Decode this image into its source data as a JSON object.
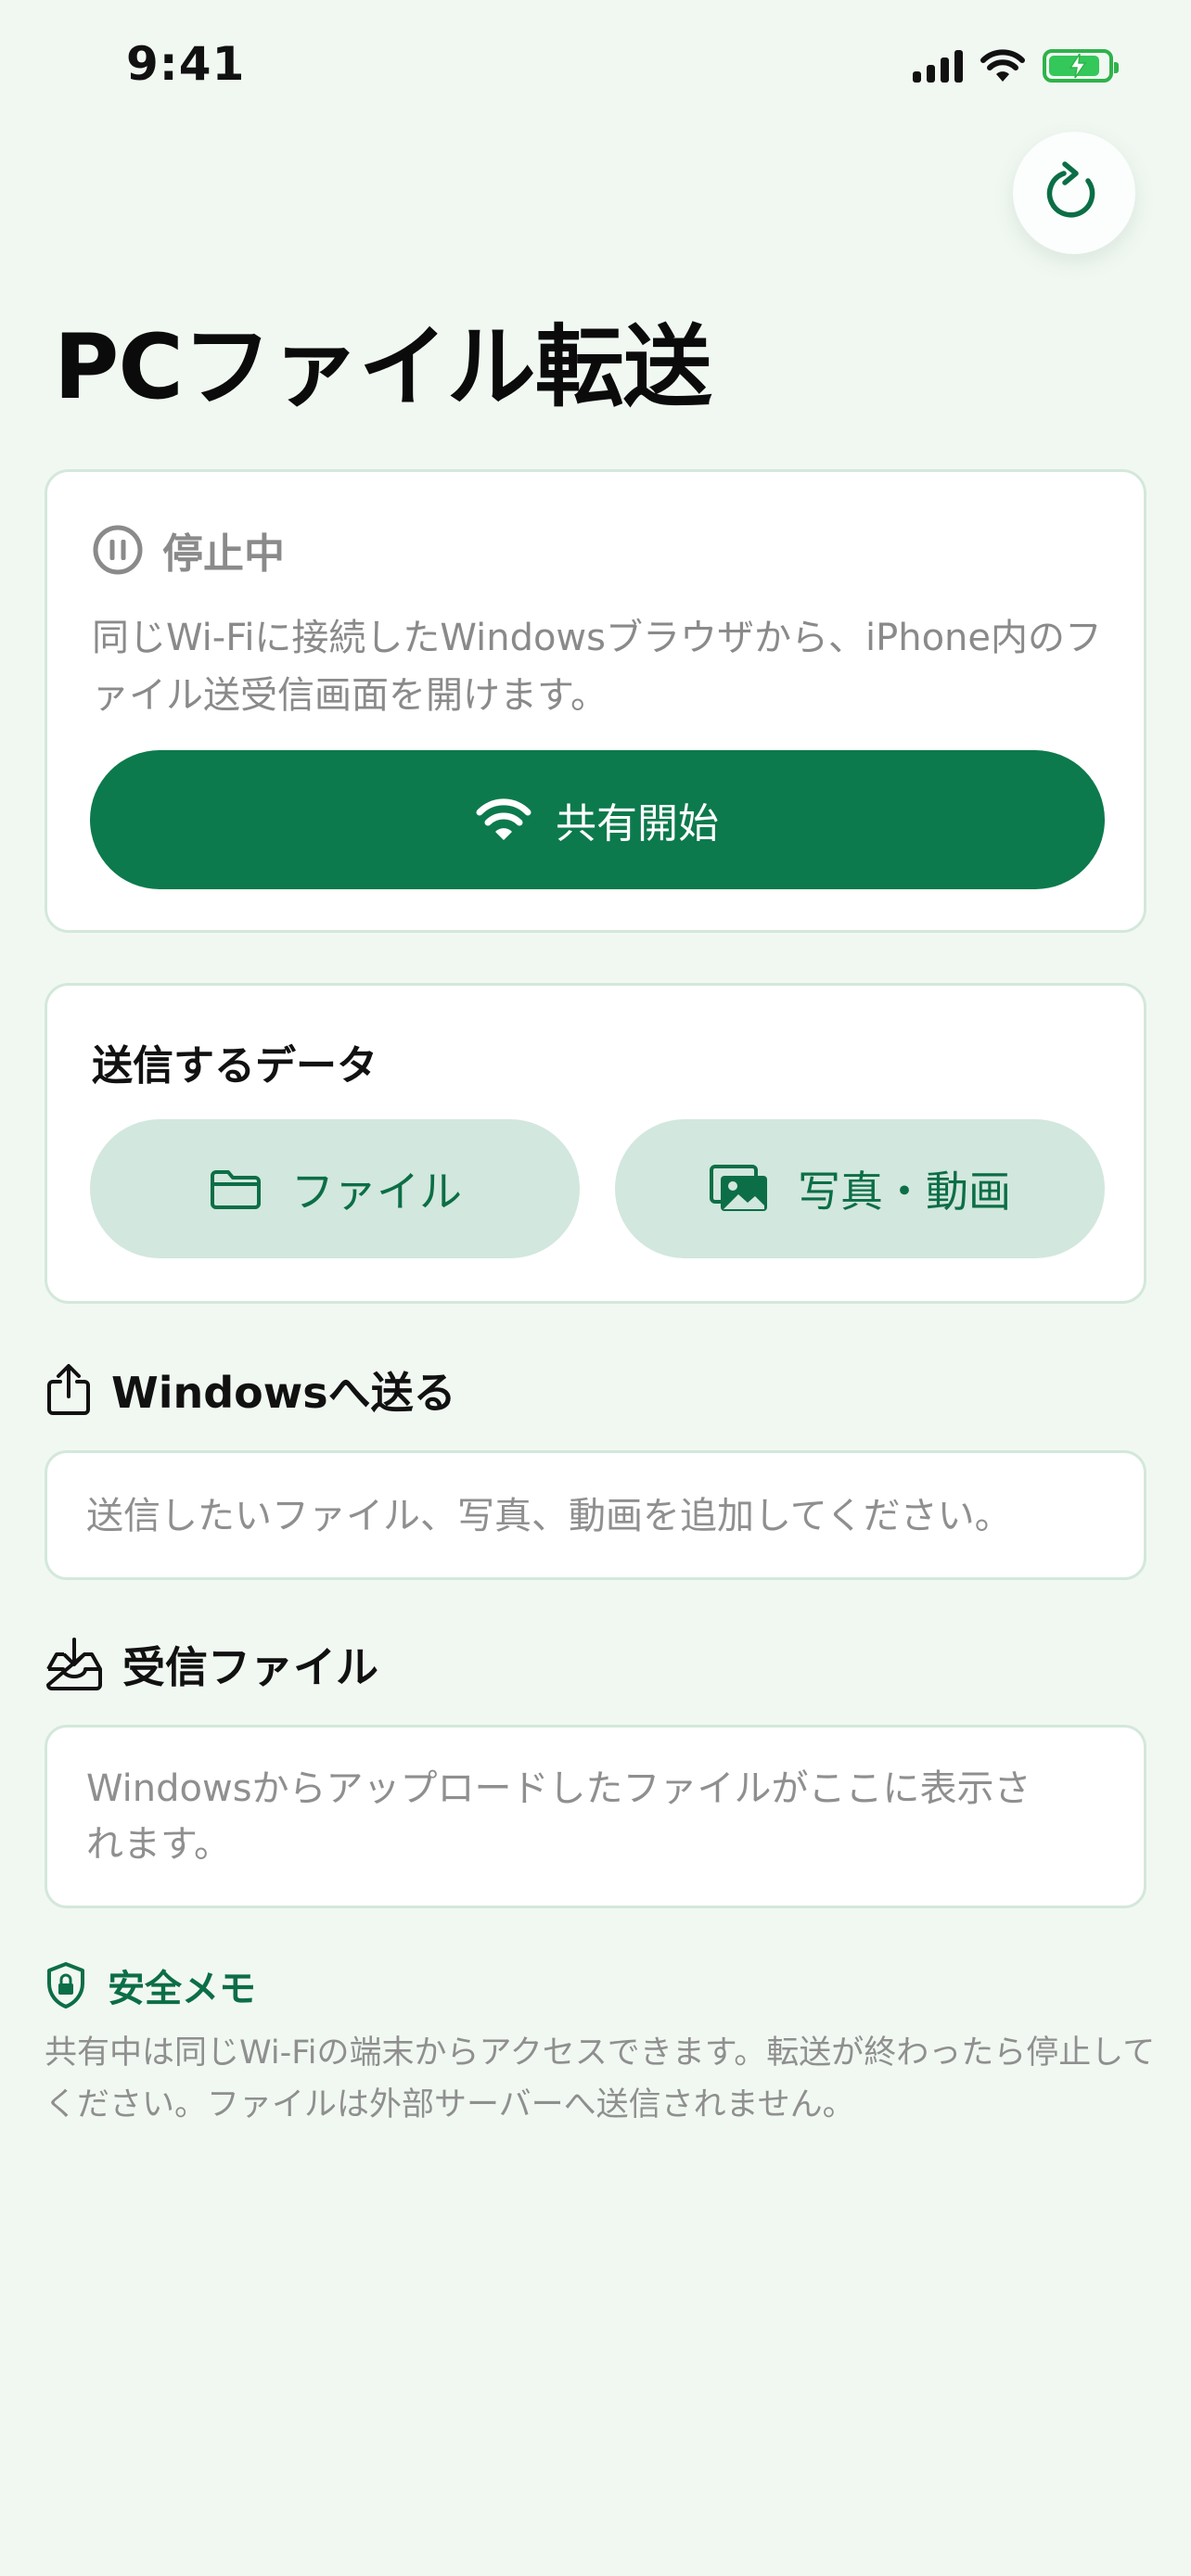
{
  "status_bar": {
    "time": "9:41"
  },
  "page": {
    "title": "PCファイル転送"
  },
  "server_card": {
    "status": "停止中",
    "description": "同じWi-Fiに接続したWindowsブラウザから、iPhone内のファイル送受信画面を開けます。",
    "share_button": "共有開始"
  },
  "data_card": {
    "title": "送信するデータ",
    "files_button": "ファイル",
    "media_button": "写真・動画"
  },
  "send_section": {
    "title": "Windowsへ送る",
    "empty_text": "送信したいファイル、写真、動画を追加してください。"
  },
  "received_section": {
    "title": "受信ファイル",
    "empty_text": "Windowsからアップロードしたファイルがここに表示されます。"
  },
  "safety": {
    "title": "安全メモ",
    "body": "共有中は同じWi-Fiの端末からアクセスできます。転送が終わったら停止してください。ファイルは外部サーバーへ送信されません。"
  },
  "colors": {
    "accent": "#0c7a4c",
    "accent_light": "#d2e7de",
    "background": "#f1f8f2",
    "muted_text": "#8a8a8a"
  },
  "icons": [
    "refresh-icon",
    "pause-circle-icon",
    "wifi-icon",
    "folder-icon",
    "photos-icon",
    "share-upload-icon",
    "inbox-download-icon",
    "shield-lock-icon"
  ]
}
